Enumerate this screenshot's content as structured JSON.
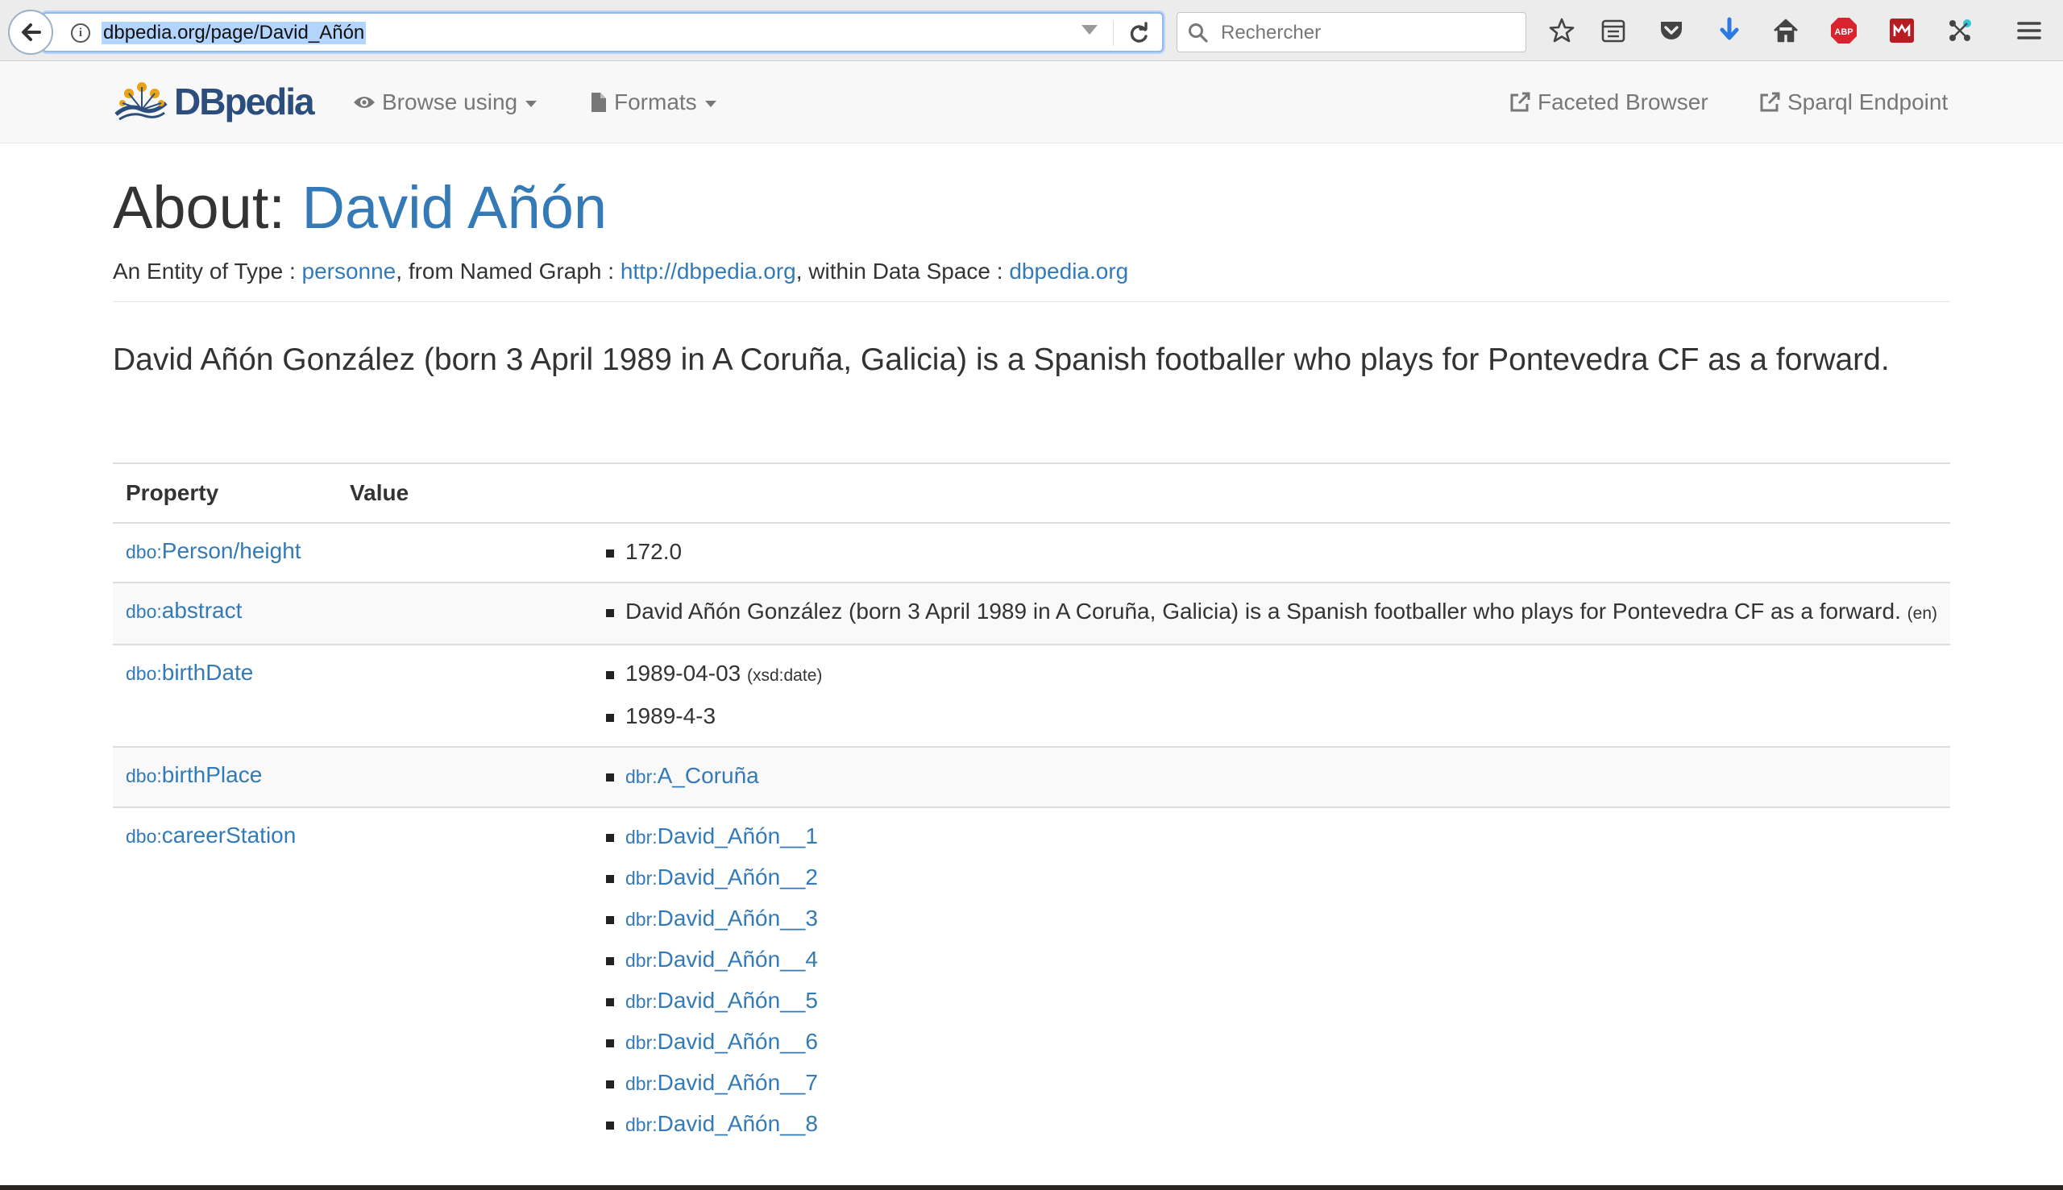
{
  "browser": {
    "url": "dbpedia.org/page/David_Añón",
    "search_placeholder": "Rechercher"
  },
  "navbar": {
    "logo_text": "DBpedia",
    "browse_using": "Browse using",
    "formats": "Formats",
    "faceted_browser": "Faceted Browser",
    "sparql_endpoint": "Sparql Endpoint"
  },
  "header": {
    "about_prefix": "About: ",
    "entity_name": "David Añón",
    "meta_type_label": "An Entity of Type : ",
    "meta_type_value": "personne",
    "meta_graph_label": ", from Named Graph : ",
    "meta_graph_value": "http://dbpedia.org",
    "meta_space_label": ", within Data Space : ",
    "meta_space_value": "dbpedia.org"
  },
  "lead": "David Añón González (born 3 April 1989 in A Coruña, Galicia) is a Spanish footballer who plays for Pontevedra CF as a forward.",
  "table": {
    "col_property": "Property",
    "col_value": "Value",
    "rows": [
      {
        "prefix": "dbo:",
        "name": "Person/height",
        "values": [
          {
            "text": "172.0"
          }
        ]
      },
      {
        "prefix": "dbo:",
        "name": "abstract",
        "values": [
          {
            "text": "David Añón González (born 3 April 1989 in A Coruña, Galicia) is a Spanish footballer who plays for Pontevedra CF as a forward.",
            "suffix": "(en)"
          }
        ]
      },
      {
        "prefix": "dbo:",
        "name": "birthDate",
        "values": [
          {
            "text": "1989-04-03",
            "suffix": "(xsd:date)"
          },
          {
            "text": "1989-4-3"
          }
        ]
      },
      {
        "prefix": "dbo:",
        "name": "birthPlace",
        "values": [
          {
            "prefix": "dbr:",
            "text": "A_Coruña"
          }
        ]
      },
      {
        "prefix": "dbo:",
        "name": "careerStation",
        "values": [
          {
            "prefix": "dbr:",
            "text": "David_Añón__1"
          },
          {
            "prefix": "dbr:",
            "text": "David_Añón__2"
          },
          {
            "prefix": "dbr:",
            "text": "David_Añón__3"
          },
          {
            "prefix": "dbr:",
            "text": "David_Añón__4"
          },
          {
            "prefix": "dbr:",
            "text": "David_Añón__5"
          },
          {
            "prefix": "dbr:",
            "text": "David_Añón__6"
          },
          {
            "prefix": "dbr:",
            "text": "David_Añón__7"
          },
          {
            "prefix": "dbr:",
            "text": "David_Añón__8"
          }
        ]
      }
    ]
  },
  "colors": {
    "link": "#337ab7",
    "navbar_bg": "#f8f8f8",
    "text": "#333333"
  }
}
